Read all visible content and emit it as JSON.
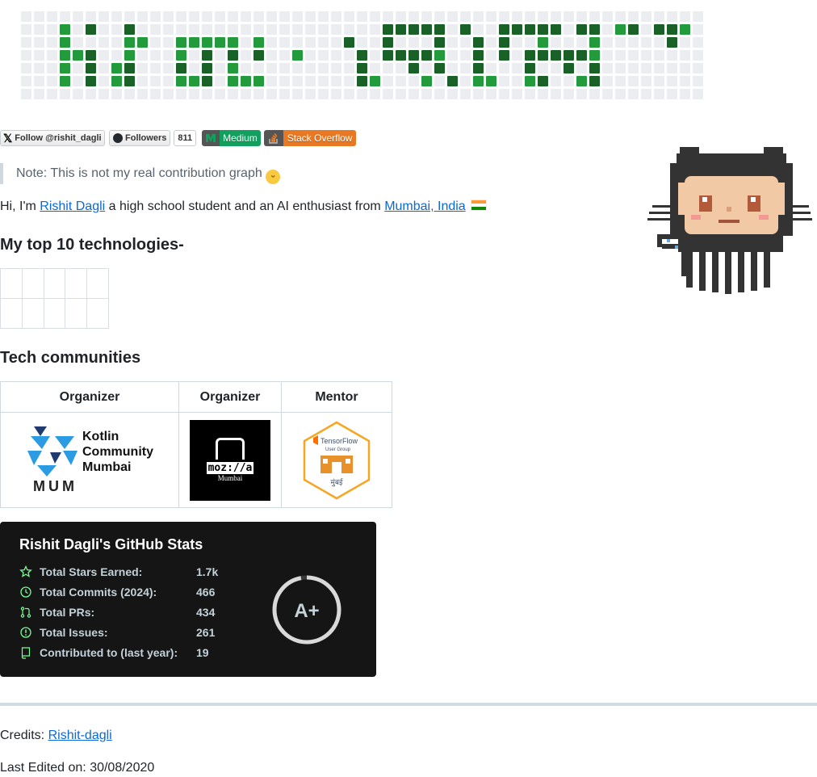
{
  "badges": {
    "twitter": "Follow @rishit_dagli",
    "followers": "Followers",
    "followers_count": "811",
    "medium": "Medium",
    "stackoverflow": "Stack Overflow"
  },
  "note": "Note: This is not my real contribution graph",
  "intro": {
    "pre": "Hi, I'm ",
    "name": "Rishit Dagli",
    "mid": " a high school student and an AI enthusiast from ",
    "location": "Mumbai, India"
  },
  "tech_heading": "My top 10 technologies-",
  "communities": {
    "heading": "Tech communities",
    "roles": [
      "Organizer",
      "Organizer",
      "Mentor"
    ],
    "kotlin": {
      "line1": "Kotlin",
      "line2": "Community",
      "line3": "Mumbai",
      "abbr": "MUM"
    },
    "mozilla": {
      "name": "moz://a",
      "city": "Mumbai"
    },
    "tensorflow": {
      "name": "TensorFlow",
      "sub": "User Group",
      "city": "मुंबई"
    }
  },
  "stats": {
    "title": "Rishit Dagli's GitHub Stats",
    "rows": [
      {
        "label": "Total Stars Earned:",
        "value": "1.7k",
        "icon": "star-icon"
      },
      {
        "label": "Total Commits (2024):",
        "value": "466",
        "icon": "history-icon"
      },
      {
        "label": "Total PRs:",
        "value": "434",
        "icon": "pull-request-icon"
      },
      {
        "label": "Total Issues:",
        "value": "261",
        "icon": "issue-icon"
      },
      {
        "label": "Contributed to (last year):",
        "value": "19",
        "icon": "repo-icon"
      }
    ],
    "grade": "A+",
    "accent": "#79ff97"
  },
  "footer": {
    "credits_label": "Credits: ",
    "credits_link": "Rishit-dagli",
    "edited": "Last Edited on: 30/08/2020"
  },
  "colors": {
    "link": "#0969da",
    "contrib_dark": "#196127",
    "contrib_mid": "#239a3b",
    "contrib_empty": "#ebedf0"
  }
}
